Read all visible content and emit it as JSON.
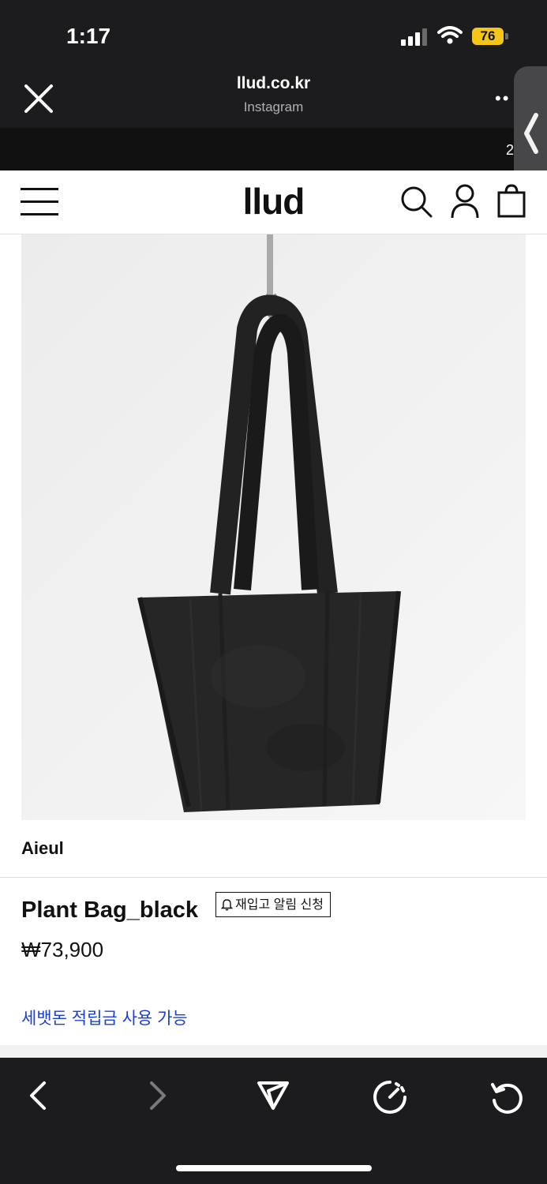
{
  "status_bar": {
    "time": "1:17",
    "battery": "76"
  },
  "browser": {
    "domain": "llud.co.kr",
    "source": "Instagram",
    "load_progress_percent": 75,
    "promo_text": "2"
  },
  "site": {
    "logo": "llud"
  },
  "product": {
    "brand": "Aieul",
    "name": "Plant Bag_black",
    "restock_label": "재입고 알림 신청",
    "price": "₩73,900",
    "points_note": "세뱃돈 적립금 사용 가능"
  },
  "colors": {
    "accent": "#1fa8f0",
    "link": "#1a3fd6",
    "battery": "#f5c518"
  }
}
